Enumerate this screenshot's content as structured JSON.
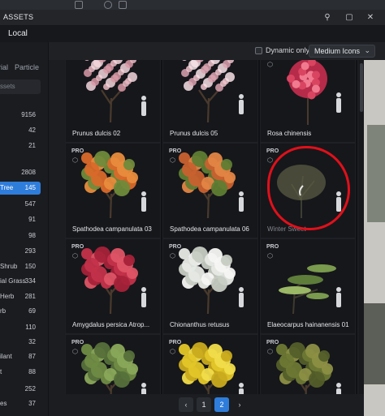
{
  "window": {
    "title": "ASSETS",
    "location": "Local"
  },
  "filters": {
    "dynamic_only_label": "Dynamic only",
    "icon_size_value": "Medium Icons"
  },
  "sidebar": {
    "tabs": [
      "rial",
      "Particle"
    ],
    "search_placeholder": "ssets",
    "rows": [
      {
        "label": "",
        "count": "9156"
      },
      {
        "label": "",
        "count": "42"
      },
      {
        "label": "",
        "count": "21"
      },
      {
        "label": "",
        "count": "2808"
      },
      {
        "label": "Tree",
        "count": "145",
        "selected": true
      },
      {
        "label": "",
        "count": "547"
      },
      {
        "label": "",
        "count": "91"
      },
      {
        "label": "",
        "count": "98"
      },
      {
        "label": "",
        "count": "293"
      },
      {
        "label": "Shrub",
        "count": "150"
      },
      {
        "label": "ial Grass",
        "count": "334"
      },
      {
        "label": "Herb",
        "count": "281"
      },
      {
        "label": "rb",
        "count": "69"
      },
      {
        "label": "",
        "count": "110"
      },
      {
        "label": "",
        "count": "32"
      },
      {
        "label": "ilant",
        "count": "87"
      },
      {
        "label": "t",
        "count": "88"
      },
      {
        "label": "",
        "count": "252"
      },
      {
        "label": "es",
        "count": "37"
      }
    ]
  },
  "assets": [
    {
      "name": "Prunus dulcis 02",
      "pro": "",
      "kind": "blossom-pink"
    },
    {
      "name": "Prunus dulcis 05",
      "pro": "",
      "kind": "blossom-pink2"
    },
    {
      "name": "Rosa chinensis",
      "pro": "",
      "kind": "rose"
    },
    {
      "name": "Spathodea campanulata 03",
      "pro": "PRO",
      "kind": "orange"
    },
    {
      "name": "Spathodea campanulata 06",
      "pro": "PRO",
      "kind": "orange2"
    },
    {
      "name": "Winter Sweet",
      "pro": "PRO",
      "kind": "bare",
      "dim": true
    },
    {
      "name": "Amygdalus persica Atrop...",
      "pro": "PRO",
      "kind": "red"
    },
    {
      "name": "Chionanthus retusus",
      "pro": "PRO",
      "kind": "white"
    },
    {
      "name": "Elaeocarpus hainanensis 01",
      "pro": "PRO",
      "kind": "layered"
    },
    {
      "name": "",
      "pro": "PRO",
      "kind": "green-sparse"
    },
    {
      "name": "",
      "pro": "PRO",
      "kind": "yellow"
    },
    {
      "name": "",
      "pro": "PRO",
      "kind": "olive"
    }
  ],
  "pagination": {
    "prev": "‹",
    "pages": [
      "1",
      "2"
    ],
    "current": "2",
    "next": "›"
  },
  "colors": {
    "accent": "#2f7ddb",
    "annotation": "#e0101a"
  }
}
